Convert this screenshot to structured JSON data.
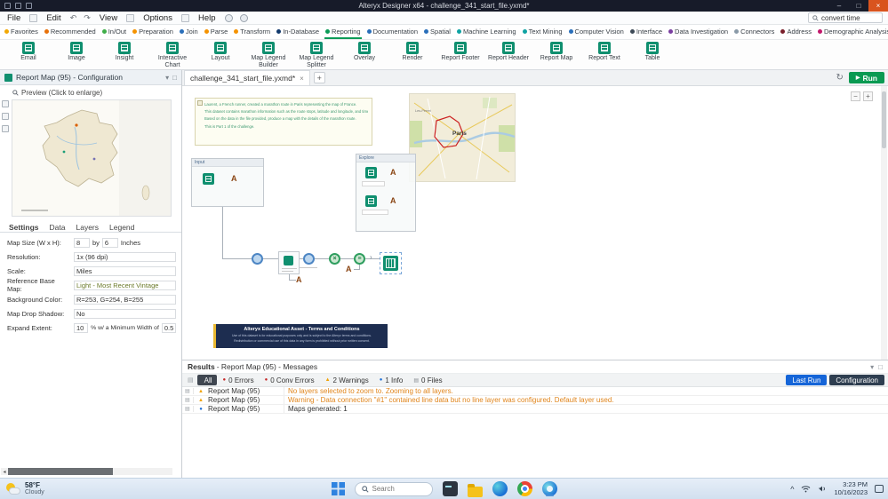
{
  "titlebar": {
    "title": "Alteryx Designer x64 - challenge_341_start_file.yxmd*"
  },
  "menubar": {
    "items": [
      {
        "label": "File"
      },
      {
        "label": "Edit"
      },
      {
        "label": "View"
      },
      {
        "label": "Options"
      },
      {
        "label": "Help"
      }
    ],
    "search_value": "convert time"
  },
  "categories": {
    "items": [
      {
        "label": "Favorites",
        "dot": "#f2a805",
        "underline": "transparent"
      },
      {
        "label": "Recommended",
        "dot": "#e8710a",
        "underline": "transparent"
      },
      {
        "label": "In/Out",
        "dot": "#3fae49",
        "underline": "transparent"
      },
      {
        "label": "Preparation",
        "dot": "#f59300",
        "underline": "transparent"
      },
      {
        "label": "Join",
        "dot": "#2a6fba",
        "underline": "transparent"
      },
      {
        "label": "Parse",
        "dot": "#f59300",
        "underline": "transparent"
      },
      {
        "label": "Transform",
        "dot": "#f59300",
        "underline": "transparent"
      },
      {
        "label": "In-Database",
        "dot": "#123a6d",
        "underline": "transparent"
      },
      {
        "label": "Reporting",
        "dot": "#0c9b57",
        "underline": "#0c9b57"
      },
      {
        "label": "Documentation",
        "dot": "#2a6fba",
        "underline": "transparent"
      },
      {
        "label": "Spatial",
        "dot": "#2a6fba",
        "underline": "transparent"
      },
      {
        "label": "Machine Learning",
        "dot": "#0fa3a3",
        "underline": "transparent"
      },
      {
        "label": "Text Mining",
        "dot": "#0fa3a3",
        "underline": "transparent"
      },
      {
        "label": "Computer Vision",
        "dot": "#2a6fba",
        "underline": "transparent"
      },
      {
        "label": "Interface",
        "dot": "#3d4a57",
        "underline": "transparent"
      },
      {
        "label": "Data Investigation",
        "dot": "#7a3fa0",
        "underline": "transparent"
      },
      {
        "label": "Connectors",
        "dot": "#8a9aa8",
        "underline": "transparent"
      },
      {
        "label": "Address",
        "dot": "#7a1f2b",
        "underline": "transparent"
      },
      {
        "label": "Demographic Analysis",
        "dot": "#c2186b",
        "underline": "transparent"
      }
    ],
    "overflow_dots": [
      {
        "color": "#f2a805"
      },
      {
        "color": "#0c9b57"
      },
      {
        "color": "#c2186b"
      }
    ]
  },
  "palette": {
    "icon_color": "#0f8f6f",
    "tools": [
      {
        "label": "Email"
      },
      {
        "label": "Image"
      },
      {
        "label": "Insight"
      },
      {
        "label": "Interactive Chart"
      },
      {
        "label": "Layout"
      },
      {
        "label": "Map Legend Builder"
      },
      {
        "label": "Map Legend Splitter"
      },
      {
        "label": "Overlay"
      },
      {
        "label": "Render"
      },
      {
        "label": "Report Footer"
      },
      {
        "label": "Report Header"
      },
      {
        "label": "Report Map"
      },
      {
        "label": "Report Text"
      },
      {
        "label": "Table"
      }
    ]
  },
  "config": {
    "header": "Report Map (95) - Configuration",
    "preview_label": "Preview (Click to enlarge)",
    "tabs": [
      {
        "label": "Settings",
        "weight": "700"
      },
      {
        "label": "Data",
        "weight": "400"
      },
      {
        "label": "Layers",
        "weight": "400"
      },
      {
        "label": "Legend",
        "weight": "400"
      }
    ],
    "fields": {
      "map_size_label": "Map Size (W x H):",
      "map_w": "8",
      "by": "by",
      "map_h": "6",
      "units": "Inches",
      "resolution_label": "Resolution:",
      "resolution": "1x (96 dpi)",
      "scale_label": "Scale:",
      "scale": "Miles",
      "base_map_label": "Reference Base Map:",
      "base_map": "Light - Most Recent Vintage",
      "bg_label": "Background Color:",
      "bg_value": "R=253, G=254, B=255",
      "shadow_label": "Map Drop Shadow:",
      "shadow": "No",
      "expand_label": "Expand Extent:",
      "expand": "10",
      "expand_mid": "% w/ a Minimum Width of",
      "expand_min": "0.5"
    }
  },
  "canvas": {
    "tab_title": "challenge_341_start_file.yxmd*",
    "run_label": "Run",
    "comment_lines": [
      {
        "text": "Laurent, a French runner, created a marathon route in Paris representing the map of France."
      },
      {
        "text": "This dataset contains marathon information such as the route stops, latitude and longitude, and timestamps."
      },
      {
        "text": "Based on the data in the file provided, produce a map with the details of the marathon route."
      },
      {
        "text": ""
      },
      {
        "text": "This is Part 1 of the challenge."
      }
    ],
    "containers": [
      {
        "title": "Input"
      },
      {
        "title": "Explore"
      }
    ],
    "map": {
      "city": "Paris",
      "district": "Les-Perret"
    },
    "banner": {
      "title": "Alteryx Educational Asset - Terms and Conditions",
      "line1": "Use of this dataset is for educational purposes only and is subject to the Alteryx terms and conditions.",
      "line2": "Redistribution or commercial use of this data in any form is prohibited without prior written consent."
    }
  },
  "results": {
    "header_bold": "Results",
    "header_rest": " - Report Map (95) - Messages",
    "filters": [
      {
        "label": "All",
        "glyph": "",
        "glyph_color": "transparent",
        "bg": "#3f4650",
        "color": "#ffffff"
      },
      {
        "label": "0 Errors",
        "glyph": "●",
        "glyph_color": "#c62828",
        "bg": "transparent",
        "color": "#333333"
      },
      {
        "label": "0 Conv Errors",
        "glyph": "●",
        "glyph_color": "#c62828",
        "bg": "transparent",
        "color": "#333333"
      },
      {
        "label": "2 Warnings",
        "glyph": "▲",
        "glyph_color": "#f0a30a",
        "bg": "transparent",
        "color": "#333333"
      },
      {
        "label": "1 Info",
        "glyph": "●",
        "glyph_color": "#1f6fd6",
        "bg": "transparent",
        "color": "#333333"
      },
      {
        "label": "0 Files",
        "glyph": "▤",
        "glyph_color": "#8a8f94",
        "bg": "transparent",
        "color": "#333333"
      }
    ],
    "last_run": "Last Run",
    "configuration": "Configuration",
    "messages": [
      {
        "source": "Report Map (95)",
        "text": "No layers selected to zoom to.  Zooming to all layers.",
        "glyph": "▲",
        "glyph_color": "#f0a30a",
        "color": "#e0851c"
      },
      {
        "source": "Report Map (95)",
        "text": "Warning - Data connection \"#1\" contained line data but no line layer was configured.  Default layer used.",
        "glyph": "▲",
        "glyph_color": "#f0a30a",
        "color": "#e0851c"
      },
      {
        "source": "Report Map (95)",
        "text": "Maps generated: 1",
        "glyph": "●",
        "glyph_color": "#1f6fd6",
        "color": "#333333"
      }
    ]
  },
  "taskbar": {
    "weather_temp": "58°F",
    "weather_desc": "Cloudy",
    "search_placeholder": "Search",
    "time": "3:23 PM",
    "date": "10/16/2023"
  },
  "icons": {
    "minimize": "–",
    "maximize": "□",
    "close": "×",
    "undo": "↶",
    "redo": "↷",
    "refresh": "↻",
    "plus": "+",
    "close_tab": "×",
    "zoom_out": "−",
    "zoom_in": "+",
    "play": "▶",
    "caret": "›",
    "grid": "▤",
    "chevron_up": "^",
    "pin": "▾",
    "popout": "□",
    "scroll_left": "◂"
  }
}
